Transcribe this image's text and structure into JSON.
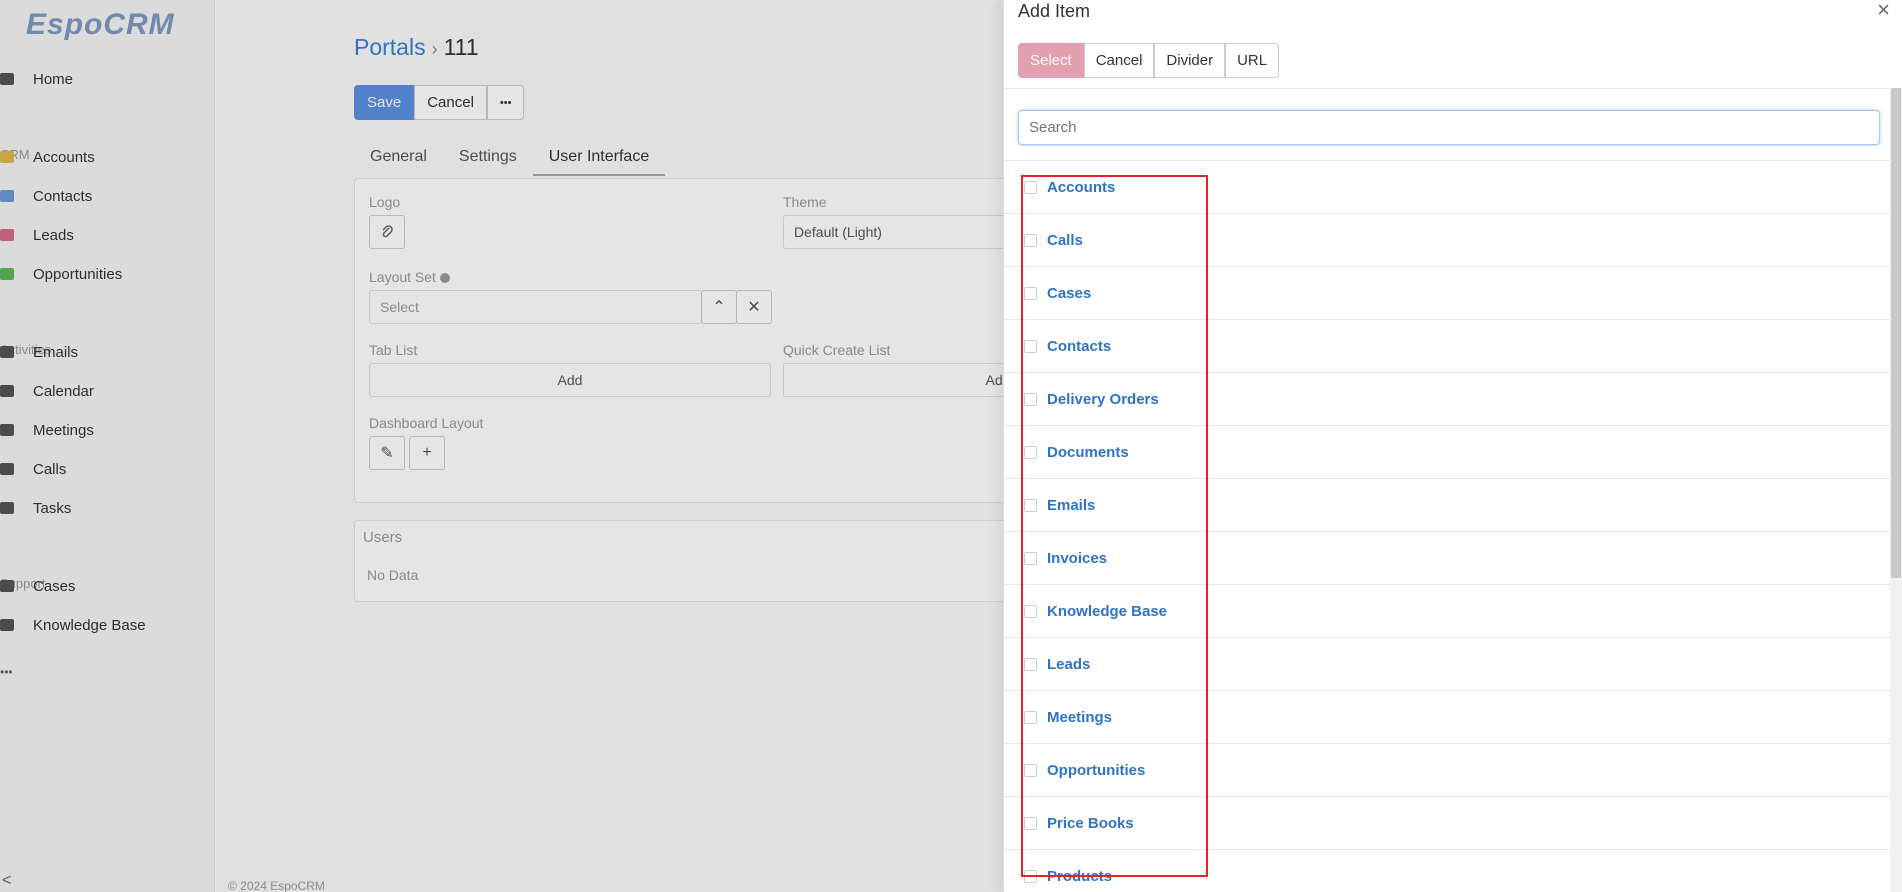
{
  "sidebar": {
    "logo": "EspoCRM",
    "items": [
      {
        "label": "Home",
        "color": "#555555"
      },
      {
        "group": "CRM"
      },
      {
        "label": "Accounts",
        "color": "#e0b84a"
      },
      {
        "label": "Contacts",
        "color": "#6b9ad6"
      },
      {
        "label": "Leads",
        "color": "#d66b8a"
      },
      {
        "label": "Opportunities",
        "color": "#5cb85c"
      },
      {
        "group": "Activities"
      },
      {
        "label": "Emails",
        "color": "#555555"
      },
      {
        "label": "Calendar",
        "color": "#555555"
      },
      {
        "label": "Meetings",
        "color": "#555555"
      },
      {
        "label": "Calls",
        "color": "#555555"
      },
      {
        "label": "Tasks",
        "color": "#555555"
      },
      {
        "group": "Support"
      },
      {
        "label": "Cases",
        "color": "#555555"
      },
      {
        "label": "Knowledge Base",
        "color": "#555555"
      }
    ],
    "more": "•••",
    "collapse": "<"
  },
  "page": {
    "breadcrumb_root": "Portals",
    "breadcrumb_sep": "›",
    "breadcrumb_current": "111",
    "save": "Save",
    "cancel": "Cancel",
    "more": "•••",
    "tabs": [
      "General",
      "Settings",
      "User Interface"
    ],
    "logo_label": "Logo",
    "theme_label": "Theme",
    "theme_value": "Default (Light)",
    "layout_set_label": "Layout Set",
    "layout_set_placeholder": "Select",
    "tab_list_label": "Tab List",
    "tab_list_add": "Add",
    "quick_create_label": "Quick Create List",
    "quick_create_add": "Add",
    "dashboard_label": "Dashboard Layout",
    "users_label": "Users",
    "users_empty": "No Data",
    "footer": "© 2024 EspoCRM"
  },
  "modal": {
    "title": "Add Item",
    "close": "×",
    "buttons": [
      "Select",
      "Cancel",
      "Divider",
      "URL"
    ],
    "search_placeholder": "Search",
    "items": [
      "Accounts",
      "Calls",
      "Cases",
      "Contacts",
      "Delivery Orders",
      "Documents",
      "Emails",
      "Invoices",
      "Knowledge Base",
      "Leads",
      "Meetings",
      "Opportunities",
      "Price Books",
      "Products"
    ]
  }
}
